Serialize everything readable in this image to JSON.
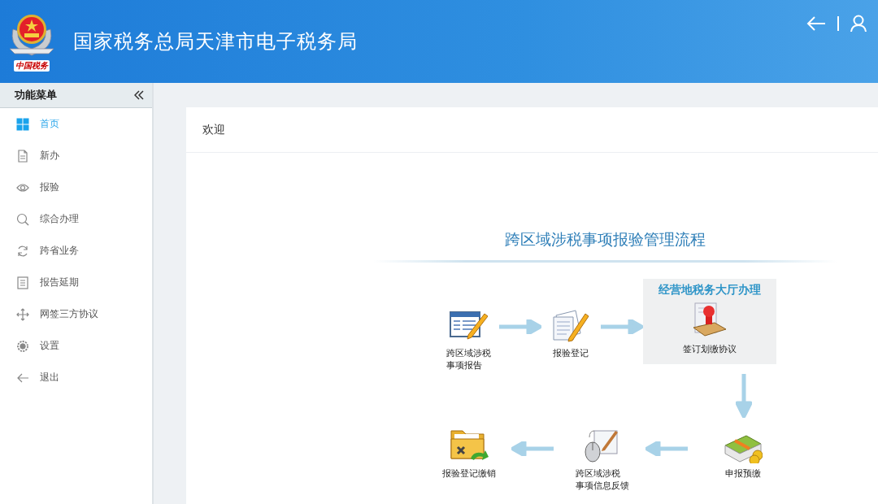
{
  "header": {
    "title": "国家税务总局天津市电子税务局",
    "logo_text": "中国税务"
  },
  "sidebar": {
    "title": "功能菜单",
    "items": [
      {
        "label": "首页",
        "kind": "grid",
        "selected": true
      },
      {
        "label": "新办",
        "kind": "document",
        "selected": false
      },
      {
        "label": "报验",
        "kind": "eye",
        "selected": false
      },
      {
        "label": "综合办理",
        "kind": "search",
        "selected": false
      },
      {
        "label": "跨省业务",
        "kind": "refresh",
        "selected": false
      },
      {
        "label": "报告延期",
        "kind": "list",
        "selected": false
      },
      {
        "label": "网签三方协议",
        "kind": "move",
        "selected": false
      },
      {
        "label": "设置",
        "kind": "gear",
        "selected": false
      },
      {
        "label": "退出",
        "kind": "exit",
        "selected": false
      }
    ]
  },
  "panel": {
    "title": "欢迎"
  },
  "flow": {
    "title": "跨区域涉税事项报验管理流程",
    "hall_title": "经营地税务大厅办理",
    "steps": [
      {
        "label_lines": [
          "跨区域涉税",
          "事项报告"
        ],
        "kind": "report"
      },
      {
        "label_lines": [
          "报验登记"
        ],
        "kind": "register"
      },
      {
        "label_lines": [
          "签订划缴协议"
        ],
        "kind": "agreement"
      },
      {
        "label_lines": [
          "报验登记缴销"
        ],
        "kind": "cancel"
      },
      {
        "label_lines": [
          "跨区域涉税",
          "事项信息反馈"
        ],
        "kind": "feedback"
      },
      {
        "label_lines": [
          "申报预缴"
        ],
        "kind": "prepay"
      }
    ]
  }
}
